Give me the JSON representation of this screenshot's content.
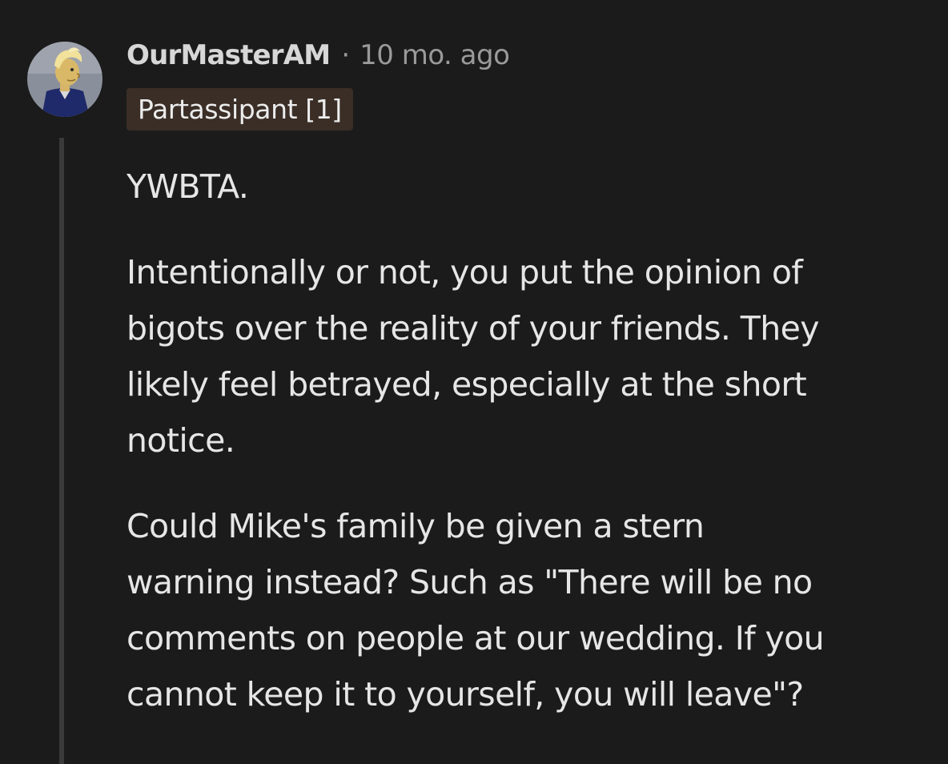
{
  "comment": {
    "username": "OurMasterAM",
    "separator": "·",
    "timestamp": "10 mo. ago",
    "flair": "Partassipant [1]",
    "avatar_icon": "user-avatar-icon",
    "paragraphs": [
      "YWBTA.",
      "Intentionally or not, you put the opinion of\nbigots over the reality of your friends. They\nlikely feel betrayed, especially at the short\nnotice.",
      "Could Mike's family be given a stern\nwarning instead? Such as \"There will be no\ncomments on people at our wedding. If you\ncannot keep it to yourself, you will leave\"?"
    ]
  },
  "colors": {
    "background": "#1b1b1b",
    "flair_background": "#3a2e27",
    "thread_line": "#3a3a3a",
    "text": "#e6e6e6",
    "muted_text": "#9a9a9a"
  }
}
